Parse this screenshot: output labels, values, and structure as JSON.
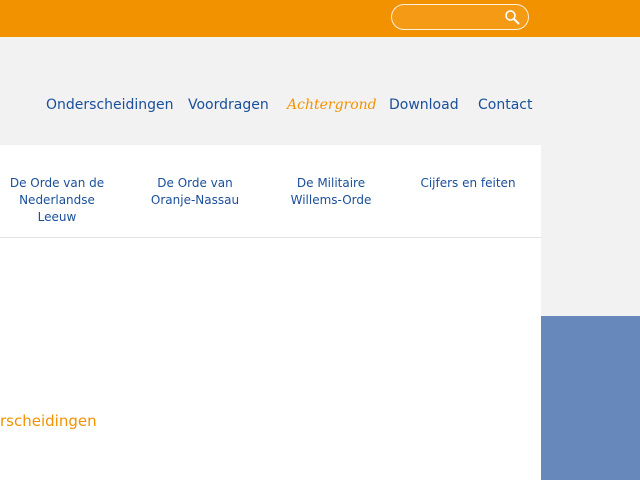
{
  "topbar": {
    "search": {
      "value": "",
      "placeholder": "",
      "icon": "search-icon"
    }
  },
  "nav": {
    "items": [
      {
        "label": "Onderscheidingen",
        "active": false
      },
      {
        "label": "Voordragen",
        "active": false
      },
      {
        "label": "Achtergrond",
        "active": true
      },
      {
        "label": "Download",
        "active": false
      },
      {
        "label": "Contact",
        "active": false
      }
    ]
  },
  "subnav": {
    "items": [
      {
        "line1": "De Orde van de",
        "line2": "Nederlandse",
        "line3": "Leeuw"
      },
      {
        "line1": "De Orde van",
        "line2": "Oranje-Nassau"
      },
      {
        "line1": "De Militaire",
        "line2": "Willems-Orde"
      },
      {
        "line1": "Cijfers en feiten"
      }
    ]
  },
  "content": {
    "headline": "rscheidingen"
  },
  "colors": {
    "accent_orange": "#f39200",
    "link_blue": "#1a4f9a",
    "block_blue": "#6688bb"
  }
}
